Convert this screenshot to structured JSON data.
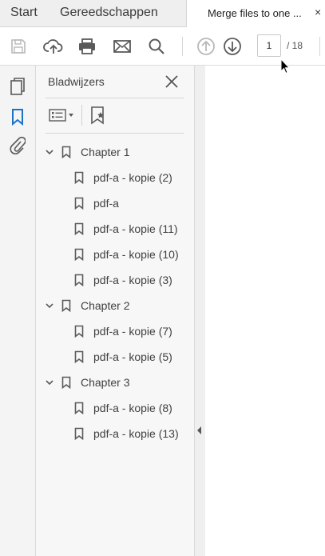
{
  "tabs": {
    "start": "Start",
    "tools": "Gereedschappen",
    "document": "Merge files to one ...",
    "close": "×"
  },
  "toolbar": {
    "page_current": "1",
    "page_total": "/ 18"
  },
  "panel": {
    "title": "Bladwijzers"
  },
  "bookmarks": [
    {
      "label": "Chapter 1",
      "children": [
        "pdf-a - kopie (2)",
        "pdf-a",
        "pdf-a - kopie (11)",
        "pdf-a - kopie (10)",
        "pdf-a - kopie (3)"
      ]
    },
    {
      "label": "Chapter 2",
      "children": [
        "pdf-a - kopie (7)",
        "pdf-a - kopie (5)"
      ]
    },
    {
      "label": "Chapter 3",
      "children": [
        "pdf-a - kopie (8)",
        "pdf-a - kopie (13)"
      ]
    }
  ],
  "colors": {
    "accent": "#1a73c7",
    "icon": "#5a5a5a",
    "disabled_icon": "#b8b8b8"
  }
}
